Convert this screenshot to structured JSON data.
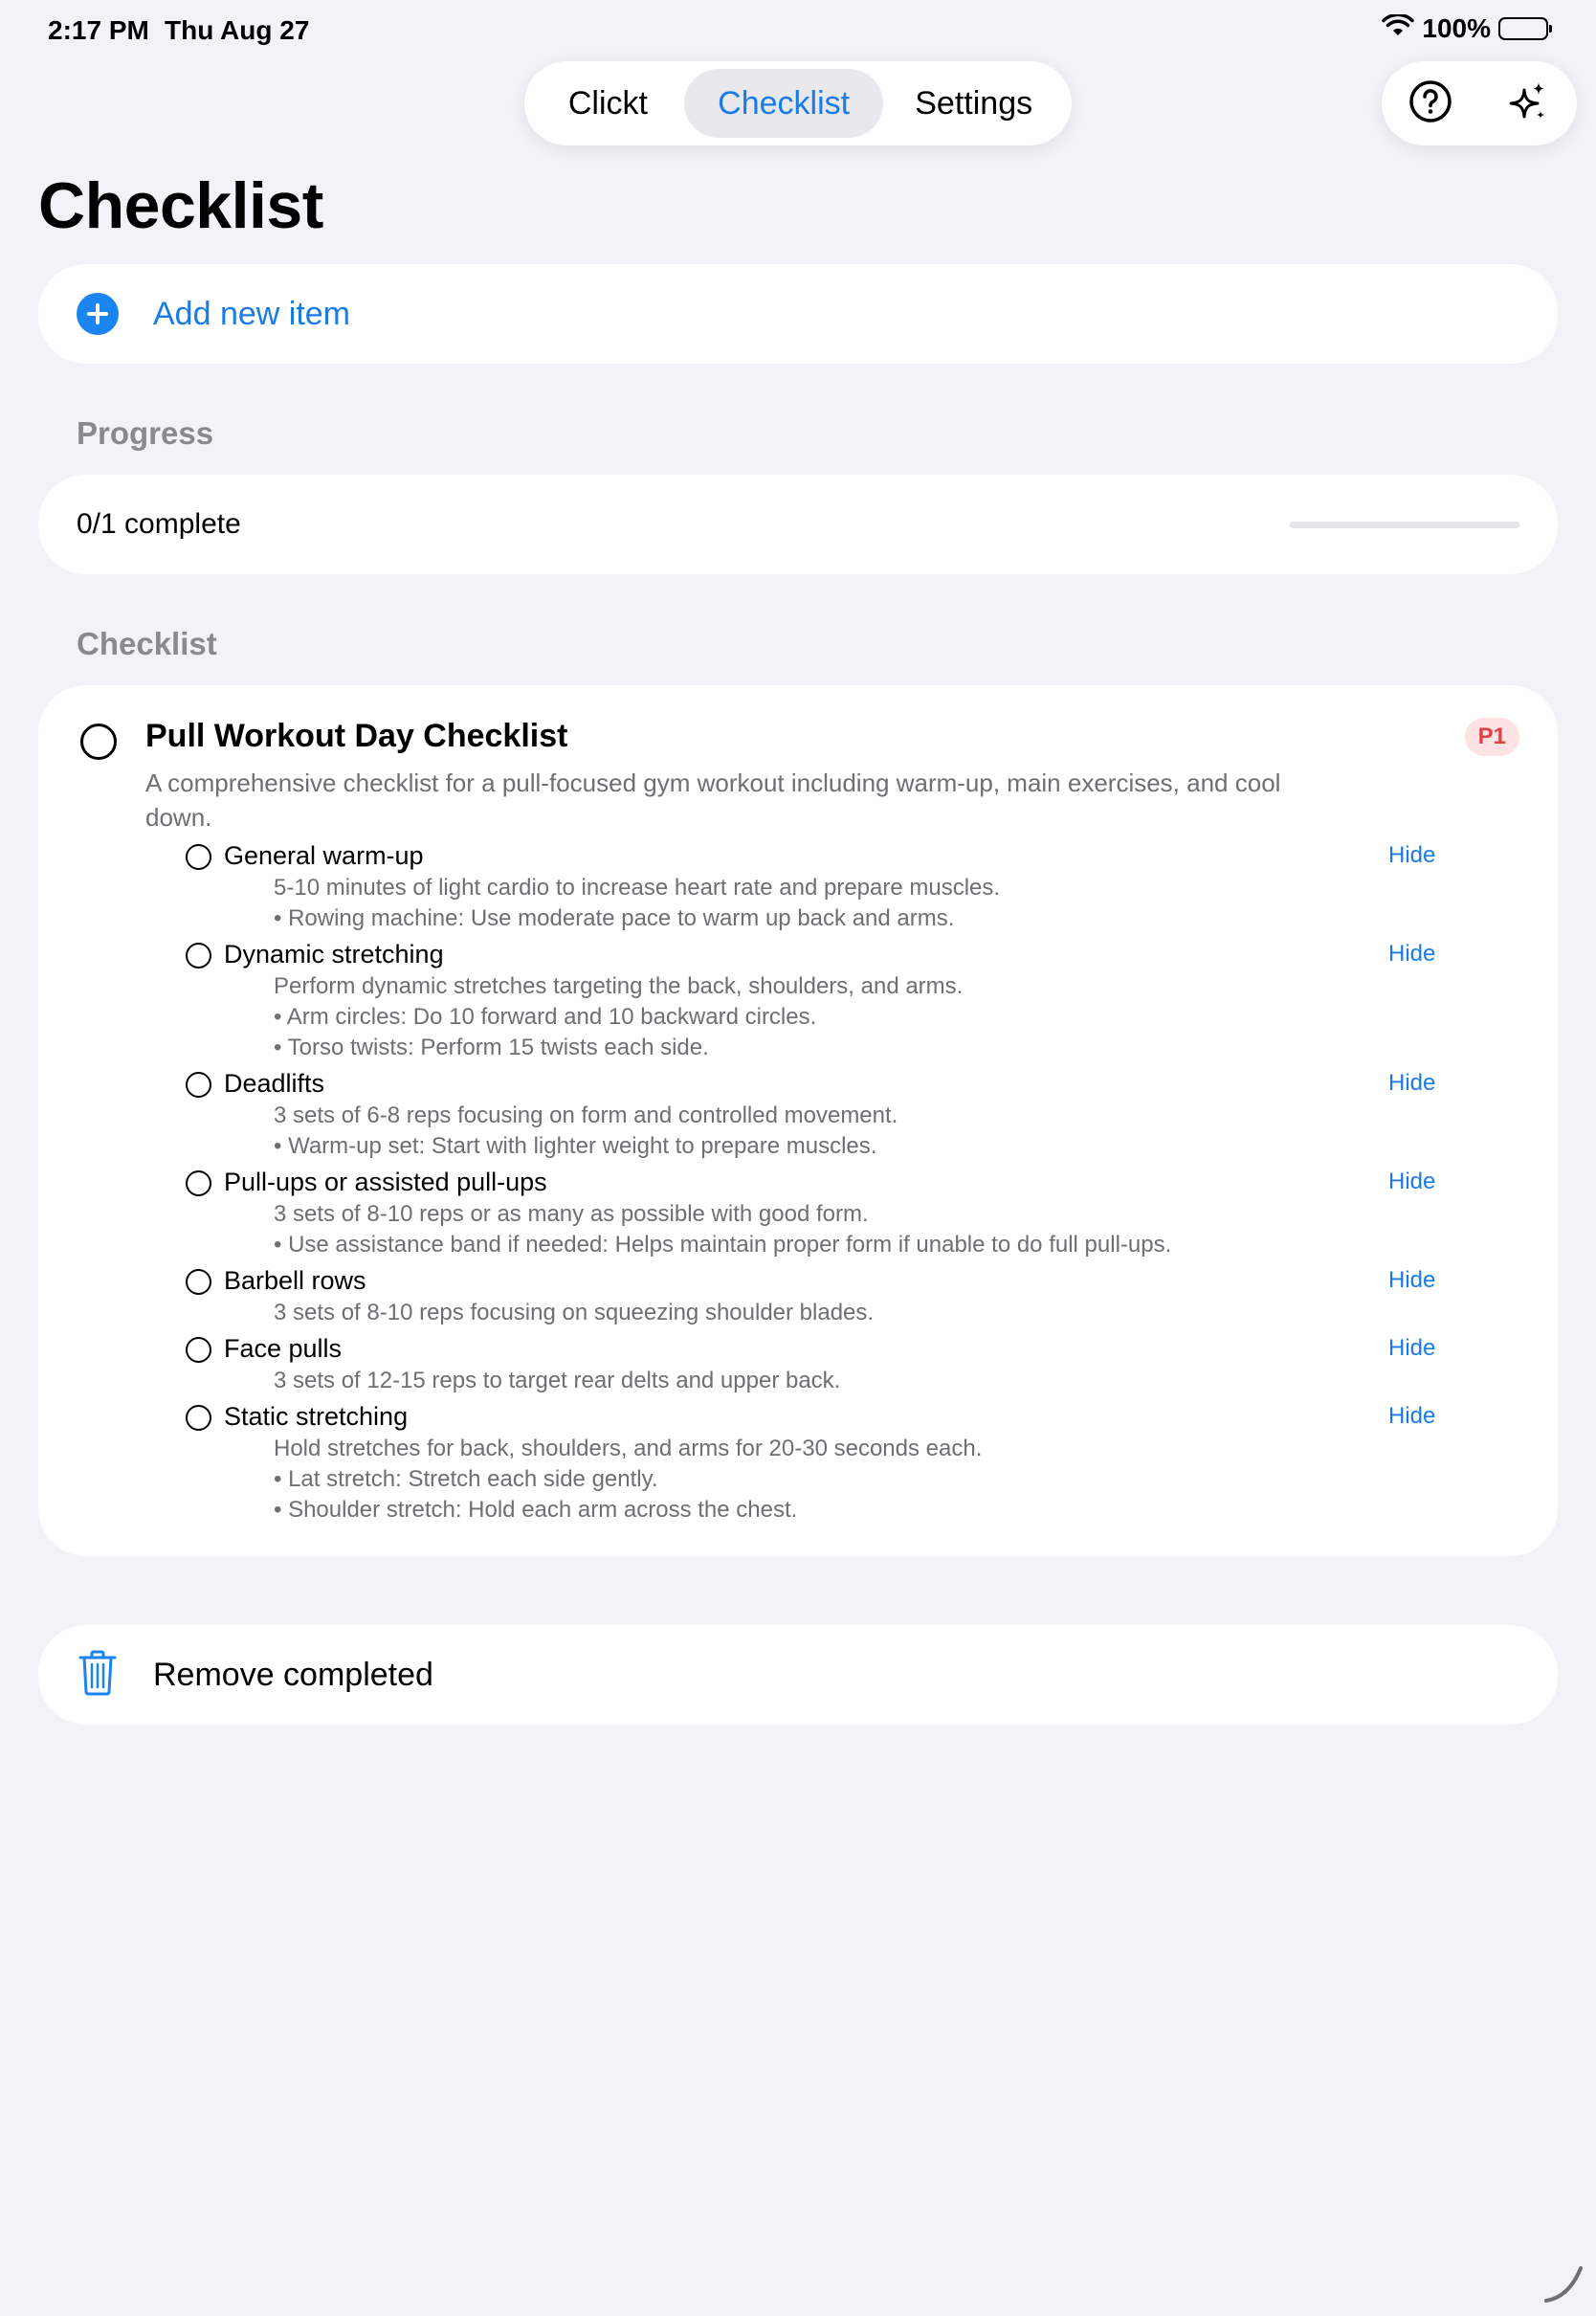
{
  "status_bar": {
    "time": "2:17 PM",
    "date": "Thu Aug 27",
    "battery": "100%"
  },
  "tabs": [
    {
      "label": "Clickt",
      "selected": false
    },
    {
      "label": "Checklist",
      "selected": true
    },
    {
      "label": "Settings",
      "selected": false
    }
  ],
  "actions": {
    "help_icon": "question-circle-icon",
    "ai_icon": "sparkles-icon"
  },
  "page": {
    "title": "Checklist"
  },
  "add_item": {
    "label": "Add new item",
    "icon": "plus-circle-icon"
  },
  "progress": {
    "header": "Progress",
    "text": "0/1 complete",
    "fraction": 0
  },
  "checklist": {
    "header": "Checklist",
    "item": {
      "title": "Pull Workout Day Checklist",
      "description": "A comprehensive checklist for a pull-focused gym workout including warm-up, main exercises, and cool down.",
      "priority": "P1",
      "subitems": [
        {
          "title": "General warm-up",
          "hide_label": "Hide",
          "lines": [
            "5-10 minutes of light cardio to increase heart rate and prepare muscles.",
            "• Rowing machine: Use moderate pace to warm up back and arms."
          ]
        },
        {
          "title": "Dynamic stretching",
          "hide_label": "Hide",
          "lines": [
            "Perform dynamic stretches targeting the back, shoulders, and arms.",
            "• Arm circles: Do 10 forward and 10 backward circles.",
            "• Torso twists: Perform 15 twists each side."
          ]
        },
        {
          "title": "Deadlifts",
          "hide_label": "Hide",
          "lines": [
            "3 sets of 6-8 reps focusing on form and controlled movement.",
            "• Warm-up set: Start with lighter weight to prepare muscles."
          ]
        },
        {
          "title": "Pull-ups or assisted pull-ups",
          "hide_label": "Hide",
          "lines": [
            "3 sets of 8-10 reps or as many as possible with good form.",
            "• Use assistance band if needed: Helps maintain proper form if unable to do full pull-ups."
          ]
        },
        {
          "title": "Barbell rows",
          "hide_label": "Hide",
          "lines": [
            "3 sets of 8-10 reps focusing on squeezing shoulder blades."
          ]
        },
        {
          "title": "Face pulls",
          "hide_label": "Hide",
          "lines": [
            "3 sets of 12-15 reps to target rear delts and upper back."
          ]
        },
        {
          "title": "Static stretching",
          "hide_label": "Hide",
          "lines": [
            "Hold stretches for back, shoulders, and arms for 20-30 seconds each.",
            "• Lat stretch: Stretch each side gently.",
            "• Shoulder stretch: Hold each arm across the chest."
          ]
        }
      ]
    }
  },
  "remove_completed": {
    "label": "Remove completed",
    "icon": "trash-icon"
  },
  "colors": {
    "accent": "#1a7be8",
    "background": "#f2f2f7",
    "priority_text": "#e0424a",
    "priority_bg": "#fde3e3"
  }
}
